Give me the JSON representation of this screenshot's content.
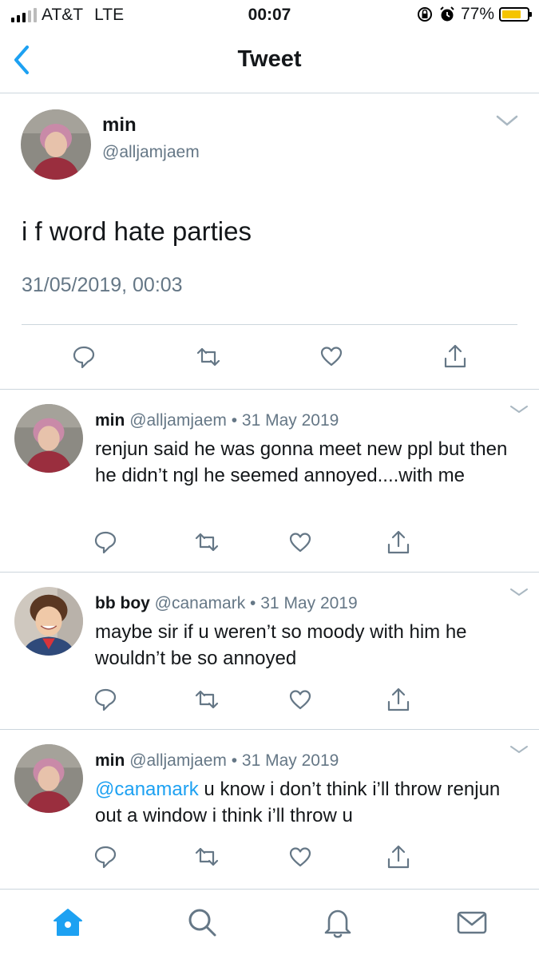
{
  "status_bar": {
    "carrier": "AT&T",
    "network": "LTE",
    "time": "00:07",
    "battery_percent": "77%",
    "battery_level": 0.77,
    "signal_bars_on": 3,
    "signal_bars_total": 5,
    "icons": [
      "rotation-lock-icon",
      "alarm-icon",
      "battery-icon"
    ]
  },
  "nav": {
    "title": "Tweet",
    "back_icon": "chevron-left-icon"
  },
  "main_tweet": {
    "name": "min",
    "handle": "@alljamjaem",
    "text": "i f word hate parties",
    "timestamp": "31/05/2019, 00:03",
    "actions": [
      "reply-icon",
      "retweet-icon",
      "like-icon",
      "share-icon"
    ]
  },
  "replies": [
    {
      "name": "min",
      "handle": "@alljamjaem",
      "date": "31 May 2019",
      "text": "renjun said he was gonna meet new ppl but then he didn’t ngl he seemed annoyed....with me"
    },
    {
      "name": "bb boy",
      "handle": "@canamark",
      "date": "31 May 2019",
      "text": "maybe sir if u weren’t so moody with him he wouldn’t be so annoyed"
    },
    {
      "name": "min",
      "handle": "@alljamjaem",
      "date": "31 May 2019",
      "mention": "@canamark",
      "text": "u know i don’t think i’ll throw renjun out a window i think i’ll throw u"
    }
  ],
  "separator": "•",
  "tabbar": [
    "home-icon",
    "search-icon",
    "notifications-icon",
    "messages-icon"
  ],
  "colors": {
    "accent": "#1da1f2",
    "secondary_text": "#657786",
    "divider": "#ccd6dd",
    "battery": "#f5c400"
  }
}
